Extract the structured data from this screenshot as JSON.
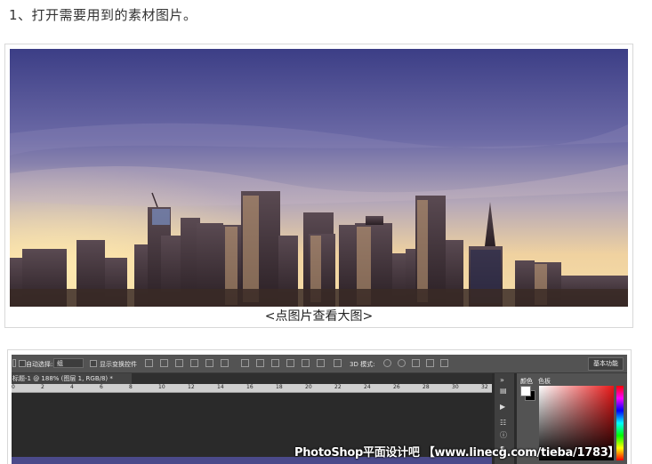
{
  "step_text": "1、打开需要用到的素材图片。",
  "figure1": {
    "caption": "<点图片查看大图>"
  },
  "photoshop": {
    "options_bar": {
      "auto_select_label": "自动选择:",
      "auto_select_value": "组",
      "show_transform_label": "显示变换控件",
      "mode_3d_label": "3D 模式:",
      "workspace_button": "基本功能"
    },
    "doc_tab": "标题-1 @ 188% (图层 1, RGB/8) *",
    "ruler_ticks": [
      "0",
      "2",
      "4",
      "6",
      "8",
      "10",
      "12",
      "14",
      "16",
      "18",
      "20",
      "22",
      "24",
      "26",
      "28",
      "30",
      "32"
    ],
    "color_panel": {
      "tabs": [
        "颜色",
        "色板"
      ]
    },
    "watermark": "PhotoShop平面设计吧 【www.linecg.com/tieba/1783】"
  },
  "colors": {
    "sky_top": "#3c3e86",
    "horizon": "#f7d9a6",
    "ps_panel": "#535353",
    "ps_canvas": "#2a2a2a"
  }
}
